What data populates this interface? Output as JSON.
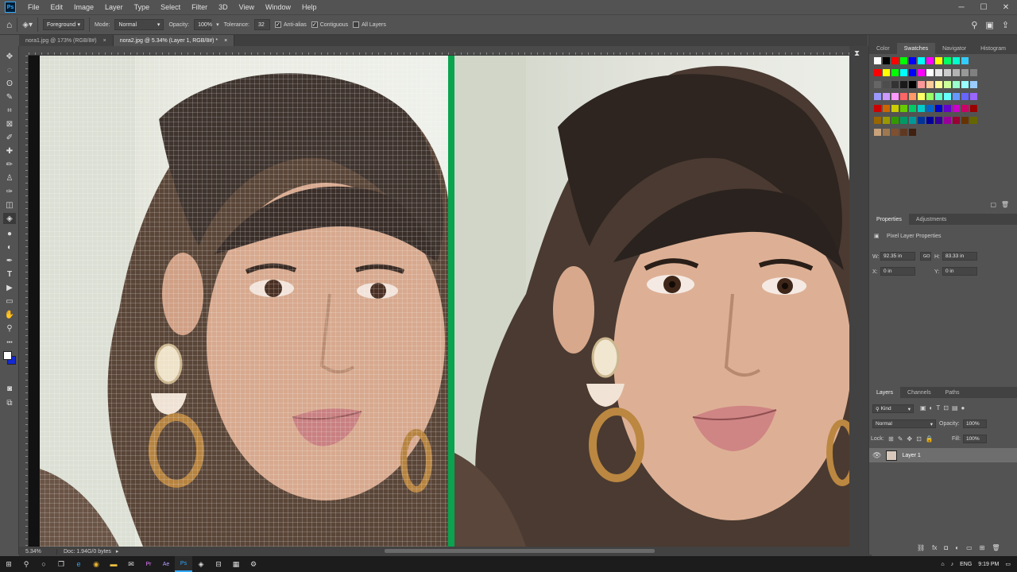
{
  "menubar": {
    "app_icon": "Ps",
    "items": [
      "File",
      "Edit",
      "Image",
      "Layer",
      "Type",
      "Select",
      "Filter",
      "3D",
      "View",
      "Window",
      "Help"
    ],
    "window_controls": [
      "minimize-icon",
      "maximize-icon",
      "close-icon"
    ]
  },
  "options": {
    "fill_source": "Foreground",
    "mode_label": "Mode:",
    "mode_value": "Normal",
    "opacity_label": "Opacity:",
    "opacity_value": "100%",
    "tolerance_label": "Tolerance:",
    "tolerance_value": "32",
    "anti_alias": "Anti-alias",
    "contiguous": "Contiguous",
    "all_layers": "All Layers"
  },
  "tabs": [
    {
      "label": "nora1.jpg @ 173% (RGB/8#)",
      "close": "×"
    },
    {
      "label": "nora2.jpg @ 5.34% (Layer 1, RGB/8#) *",
      "close": "×"
    }
  ],
  "toolbar": {
    "tools": [
      "move-icon",
      "marquee-icon",
      "lasso-icon",
      "quick-select-icon",
      "crop-icon",
      "frame-icon",
      "eyedropper-icon",
      "healing-icon",
      "brush-icon",
      "stamp-icon",
      "history-brush-icon",
      "eraser-icon",
      "paint-bucket-icon",
      "blur-icon",
      "dodge-icon",
      "pen-icon",
      "type-icon",
      "path-select-icon",
      "rectangle-icon",
      "hand-icon",
      "zoom-icon"
    ],
    "glyphs": [
      "✥",
      "◌",
      "ʘ",
      "✎",
      "⌗",
      "⊠",
      "✐",
      "✚",
      "✏",
      "♙",
      "✑",
      "◫",
      "◈",
      "●",
      "◐",
      "✒",
      "T",
      "▶",
      "▭",
      "✋",
      "⚲"
    ],
    "active_tool": "paint-bucket-icon"
  },
  "status": {
    "zoom": "5.34%",
    "doc_info": "Doc: 1.94G/0 bytes"
  },
  "swatch_panel": {
    "tabs": [
      "Color",
      "Swatches",
      "Navigator",
      "Histogram"
    ],
    "active_tab": "Swatches"
  },
  "properties_panel": {
    "tabs": [
      "Properties",
      "Adjustments"
    ],
    "active_tab": "Properties",
    "heading": "Pixel Layer Properties",
    "w_label": "W:",
    "w_value": "92.35 in",
    "link_label": "GO",
    "h_label": "H:",
    "h_value": "83.33 in",
    "x_label": "X:",
    "x_value": "0 in",
    "y_label": "Y:",
    "y_value": "0 in"
  },
  "layers_panel": {
    "tabs": [
      "Layers",
      "Channels",
      "Paths"
    ],
    "active_tab": "Layers",
    "kind_label": "Kind",
    "blend_mode": "Normal",
    "opacity_label": "Opacity:",
    "opacity_value": "100%",
    "lock_label": "Lock:",
    "fill_label": "Fill:",
    "fill_value": "100%",
    "layers": [
      {
        "name": "Layer 1"
      }
    ]
  },
  "taskbar": {
    "apps": [
      "start-icon",
      "search-icon",
      "cortana-icon",
      "task-view-icon",
      "edge-icon",
      "chrome-icon",
      "file-explorer-icon",
      "mail-icon",
      "premiere-icon",
      "after-effects-icon",
      "photoshop-icon",
      "media-icon",
      "store-icon",
      "calculator-icon",
      "settings-icon"
    ],
    "language": "ENG",
    "time": "9:19 PM"
  }
}
